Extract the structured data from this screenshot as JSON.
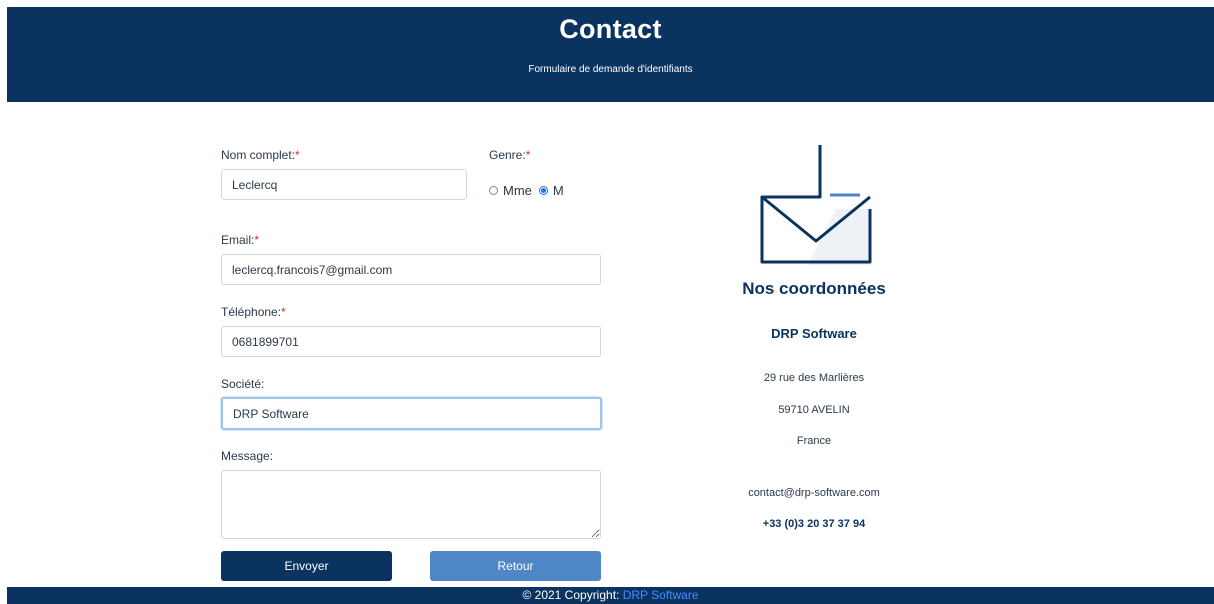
{
  "header": {
    "title": "Contact",
    "subtitle": "Formulaire de demande d'identifiants"
  },
  "form": {
    "name_label": "Nom complet:",
    "name_value": "Leclercq",
    "gender_label": "Genre:",
    "gender_options": [
      "Mme",
      "M"
    ],
    "gender_selected": "M",
    "email_label": "Email:",
    "email_value": "leclercq.francois7@gmail.com",
    "phone_label": "Téléphone:",
    "phone_value": "0681899701",
    "company_label": "Société:",
    "company_value": "DRP Software",
    "message_label": "Message:",
    "message_value": "",
    "required_marker": "*",
    "submit_label": "Envoyer",
    "back_label": "Retour"
  },
  "contact": {
    "title": "Nos coordonnées",
    "company": "DRP Software",
    "address_line1": "29 rue des Marlières",
    "address_line2": "59710 AVELIN",
    "country": "France",
    "email": "contact@drp-software.com",
    "phone": "+33 (0)3 20 37 37 94",
    "icon": "mail-inbox-icon"
  },
  "footer": {
    "copyright": "© 2021 Copyright: ",
    "link_text": "DRP Software"
  },
  "colors": {
    "primary": "#0b3360",
    "secondary": "#4f86c6",
    "required": "#d62b2b",
    "link": "#3f8cff"
  }
}
